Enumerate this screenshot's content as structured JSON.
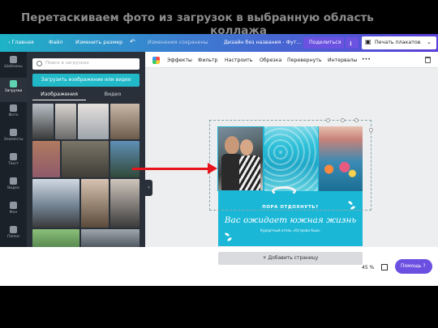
{
  "caption": {
    "line1": "Перетаскиваем фото из загрузок в выбранную область",
    "line2": "коллажа"
  },
  "topbar": {
    "home": "‹ Главная",
    "file": "Файл",
    "resize": "Изменить размер",
    "undo_icon": "undo-icon",
    "status": "Изменения сохранены",
    "doc_title": "Дизайн без названия - Фут...",
    "share": "Поделиться",
    "print": "Печать плакатов",
    "colors": {
      "gradient_start": "#1fb3c6",
      "gradient_end": "#5b3fd6",
      "button": "#6b52e0"
    }
  },
  "rail": {
    "items": [
      {
        "label": "Шаблоны",
        "icon": "templates-icon"
      },
      {
        "label": "Загрузки",
        "icon": "uploads-icon"
      },
      {
        "label": "Фото",
        "icon": "photos-icon"
      },
      {
        "label": "Элементы",
        "icon": "elements-icon"
      },
      {
        "label": "Текст",
        "icon": "text-icon"
      },
      {
        "label": "Видео",
        "icon": "video-icon"
      },
      {
        "label": "Фон",
        "icon": "background-icon"
      },
      {
        "label": "Папки",
        "icon": "folders-icon"
      }
    ]
  },
  "panel": {
    "search_placeholder": "Поиск в загрузках",
    "upload_button": "Загрузить изображение или видео",
    "tab_images": "Изображения",
    "tab_video": "Видео"
  },
  "toolbar": {
    "effects": "Эффекты",
    "filter": "Фильтр",
    "adjust": "Настроить",
    "crop": "Обрезка",
    "flip": "Перевернуть",
    "spacing": "Интервалы",
    "more": "•••"
  },
  "design": {
    "line1": "ПОРА ОТДОХНУТЬ?",
    "line2": "Вас ожидает южная жизнь",
    "line3": "Курортный отель «Острова Аша»",
    "accent": "#1bb7d7"
  },
  "add_page": "+ Добавить страницу",
  "zoom": "45 %",
  "help": "Помощь  ?"
}
